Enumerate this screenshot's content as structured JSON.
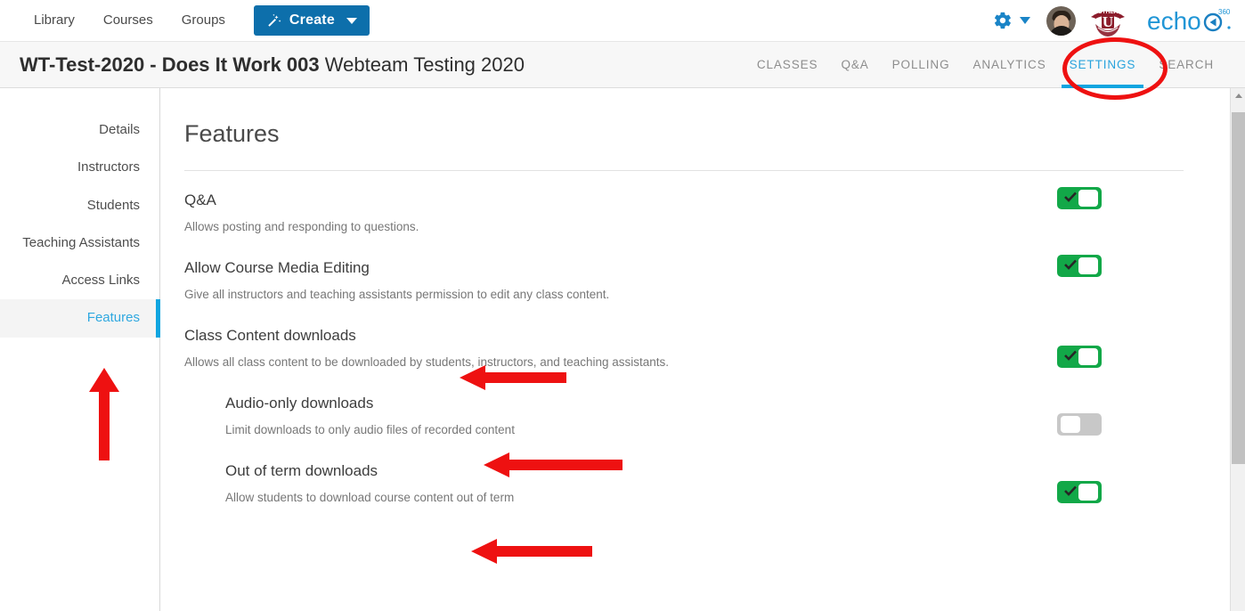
{
  "topnav": {
    "links": [
      {
        "label": "Library"
      },
      {
        "label": "Courses"
      },
      {
        "label": "Groups"
      }
    ],
    "create_button": {
      "label": "Create",
      "icon": "magic-wand-icon",
      "caret": "chevron-down-icon"
    },
    "gear": {
      "icon": "gear-icon"
    },
    "avatar": {
      "icon": "user-avatar"
    },
    "institution_logo": {
      "name": "other-u-crest",
      "banner_text": "OTHER",
      "letter": "U"
    },
    "product_logo": {
      "name": "echo360-logo",
      "text": "echo",
      "superscript": "360"
    }
  },
  "course_header": {
    "code_and_name": "WT-Test-2020 - Does It Work 003",
    "term": "Webteam Testing 2020",
    "tabs": [
      {
        "label": "CLASSES",
        "active": false
      },
      {
        "label": "Q&A",
        "active": false
      },
      {
        "label": "POLLING",
        "active": false
      },
      {
        "label": "ANALYTICS",
        "active": false
      },
      {
        "label": "SETTINGS",
        "active": true
      },
      {
        "label": "SEARCH",
        "active": false
      }
    ]
  },
  "sidebar": {
    "items": [
      {
        "label": "Details",
        "active": false
      },
      {
        "label": "Instructors",
        "active": false
      },
      {
        "label": "Students",
        "active": false
      },
      {
        "label": "Teaching Assistants",
        "active": false
      },
      {
        "label": "Access Links",
        "active": false
      },
      {
        "label": "Features",
        "active": true
      }
    ]
  },
  "main": {
    "title": "Features",
    "features": [
      {
        "name": "Q&A",
        "description": "Allows posting and responding to questions.",
        "toggle": "on",
        "indented": false
      },
      {
        "name": "Allow Course Media Editing",
        "description": "Give all instructors and teaching assistants permission to edit any class content.",
        "toggle": "on",
        "indented": false
      },
      {
        "name": "Class Content downloads",
        "description": "Allows all class content to be downloaded by students, instructors, and teaching assistants.",
        "toggle": "on",
        "indented": false
      },
      {
        "name": "Audio-only downloads",
        "description": "Limit downloads to only audio files of recorded content",
        "toggle": "off",
        "indented": true
      },
      {
        "name": "Out of term downloads",
        "description": "Allow students to download course content out of term",
        "toggle": "on",
        "indented": true
      }
    ]
  },
  "annotations": {
    "color": "#ee1111",
    "ellipse_target": "SETTINGS",
    "arrows": [
      {
        "points_to": "Features",
        "direction": "up"
      },
      {
        "points_to": "Class Content downloads",
        "direction": "left"
      },
      {
        "points_to": "Audio-only downloads",
        "direction": "left"
      },
      {
        "points_to": "Out of term downloads",
        "direction": "left"
      }
    ]
  },
  "scrollbar": {
    "name": "vertical-scrollbar"
  },
  "colors": {
    "accent_blue": "#0fa5e0",
    "button_blue": "#0d6fab",
    "toggle_on_green": "#12a848",
    "toggle_off_gray": "#c8c8c8",
    "annotation_red": "#ee1111"
  }
}
